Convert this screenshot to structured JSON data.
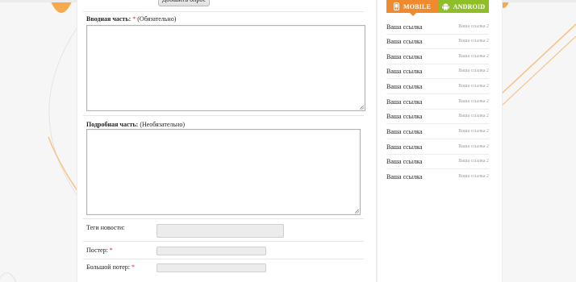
{
  "form": {
    "add_button_label": "Добавить опрос",
    "intro": {
      "label": "Вводная часть:",
      "required_mark": "*",
      "note": "(Обязательно)"
    },
    "detail": {
      "label": "Подробная часть:",
      "note": "(Необязательно)"
    },
    "tags": {
      "label": "Теги новости:",
      "value": ""
    },
    "poster": {
      "label": "Постер:",
      "required_mark": "*",
      "value": ""
    },
    "big_poster": {
      "label": "Большой потер:",
      "required_mark": "*",
      "value": ""
    }
  },
  "sidebar": {
    "tabs": [
      {
        "label": "MOBILE",
        "icon": "mobile-phone-icon",
        "color": "#f08a2e"
      },
      {
        "label": "ANDROID",
        "icon": "android-icon",
        "color": "#8fbf28"
      }
    ],
    "links": [
      {
        "title": "Ваша ссылка",
        "subtitle": "Ваша ссылка 2"
      },
      {
        "title": "Ваша ссылка",
        "subtitle": "Ваша ссылка 2"
      },
      {
        "title": "Ваша ссылка",
        "subtitle": "Ваша ссылка 2"
      },
      {
        "title": "Ваша ссылка",
        "subtitle": "Ваша ссылка 2"
      },
      {
        "title": "Ваша ссылка",
        "subtitle": "Ваша ссылка 2"
      },
      {
        "title": "Ваша ссылка",
        "subtitle": "Ваша ссылка 2"
      },
      {
        "title": "Ваша ссылка",
        "subtitle": "Ваша ссылка 2"
      },
      {
        "title": "Ваша ссылка",
        "subtitle": "Ваша ссылка 2"
      },
      {
        "title": "Ваша ссылка",
        "subtitle": "Ваша ссылка 2"
      },
      {
        "title": "Ваша ссылка",
        "subtitle": "Ваша ссылка 2"
      },
      {
        "title": "Ваша ссылка",
        "subtitle": "Ваша ссылка 2"
      }
    ]
  },
  "colors": {
    "accent_orange": "#f08a2e",
    "accent_green": "#8fbf28",
    "required": "#dd2222"
  }
}
